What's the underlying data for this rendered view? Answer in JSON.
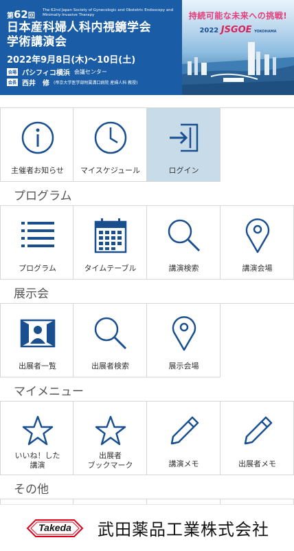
{
  "banner": {
    "edition_prefix": "第",
    "edition_num": "62",
    "edition_suffix": "回",
    "en_title": "The 62nd Japan Society of Gynecologic and Obstetric Endoscopy and Minimally Invasive Therapy",
    "jp_title_line1": "日本産科婦人科内視鏡学会",
    "jp_title_line2": "学術講演会",
    "dates": "2022年9月8日(木)〜10日(土)",
    "venue_tag": "会場",
    "venue": "パシフィコ横浜",
    "venue_detail": "会議センター",
    "chair_tag": "会長",
    "chair": "西井　修",
    "chair_affiliation": "(帝京大学医学部附属溝口病院 産婦人科 教授)",
    "slogan": "持続可能な未来への挑戦!",
    "logo_year": "2022",
    "logo_name": "JSGOE",
    "logo_city": "YOKOHAMA"
  },
  "top_menu": [
    {
      "label": "主催者お知らせ",
      "icon": "info-icon"
    },
    {
      "label": "マイスケジュール",
      "icon": "clock-icon"
    },
    {
      "label": "ログイン",
      "icon": "login-icon"
    }
  ],
  "sections": {
    "program": "プログラム",
    "exhibition": "展示会",
    "my_menu": "マイメニュー",
    "other": "その他"
  },
  "program_menu": [
    {
      "label": "プログラム",
      "icon": "list-icon"
    },
    {
      "label": "タイムテーブル",
      "icon": "calendar-icon"
    },
    {
      "label": "講演検索",
      "icon": "search-icon"
    },
    {
      "label": "講演会場",
      "icon": "location-pin-icon"
    }
  ],
  "exhibition_menu": [
    {
      "label": "出展者一覧",
      "icon": "exhibitor-icon"
    },
    {
      "label": "出展者検索",
      "icon": "search-icon"
    },
    {
      "label": "展示会場",
      "icon": "location-pin-icon"
    }
  ],
  "my_menu": [
    {
      "label1": "いいね！した",
      "label2": "講演",
      "icon": "star-icon"
    },
    {
      "label1": "出展者",
      "label2": "ブックマーク",
      "icon": "star-icon"
    },
    {
      "label": "講演メモ",
      "icon": "pencil-icon"
    },
    {
      "label": "出展者メモ",
      "icon": "pencil-icon"
    }
  ],
  "footer": {
    "logo_text": "Takeda",
    "company": "武田薬品工業株式会社"
  },
  "colors": {
    "icon_blue": "#1a4f8f",
    "banner_blue": "#1a5da6",
    "active_cell": "#c8dbe9",
    "takeda_red": "#e1001a"
  }
}
